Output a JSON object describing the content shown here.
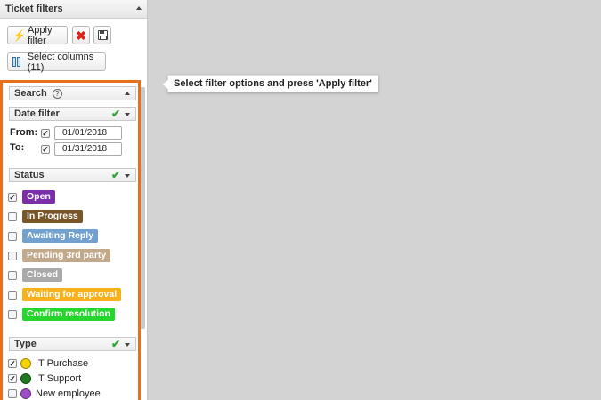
{
  "panel": {
    "title": "Ticket filters"
  },
  "toolbar": {
    "apply_label": "Apply filter",
    "select_columns_label": "Select columns (11)"
  },
  "search": {
    "title": "Search",
    "help_glyph": "?"
  },
  "date_filter": {
    "title": "Date filter",
    "from_label": "From:",
    "from_value": "01/01/2018",
    "from_checked": true,
    "to_label": "To:",
    "to_value": "01/31/2018",
    "to_checked": true
  },
  "status": {
    "title": "Status",
    "items": [
      {
        "label": "Open",
        "checked": true,
        "color": "#7b2fa8"
      },
      {
        "label": "In Progress",
        "checked": false,
        "color": "#7a5528"
      },
      {
        "label": "Awaiting Reply",
        "checked": false,
        "color": "#72a0cf"
      },
      {
        "label": "Pending 3rd party",
        "checked": false,
        "color": "#c2a98a"
      },
      {
        "label": "Closed",
        "checked": false,
        "color": "#a9a9a9"
      },
      {
        "label": "Waiting for approval",
        "checked": false,
        "color": "#f7b21b"
      },
      {
        "label": "Confirm resolution",
        "checked": false,
        "color": "#27d62c"
      }
    ]
  },
  "type": {
    "title": "Type",
    "items": [
      {
        "label": "IT Purchase",
        "checked": true,
        "color": "#f5d200"
      },
      {
        "label": "IT Support",
        "checked": true,
        "color": "#1e7a1e"
      },
      {
        "label": "New employee",
        "checked": false,
        "color": "#a04bc8"
      }
    ]
  },
  "tooltip": {
    "text": "Select filter options and press 'Apply filter'"
  },
  "colors": {
    "highlight_border": "#e8701a",
    "check_green": "#3aa33a"
  }
}
